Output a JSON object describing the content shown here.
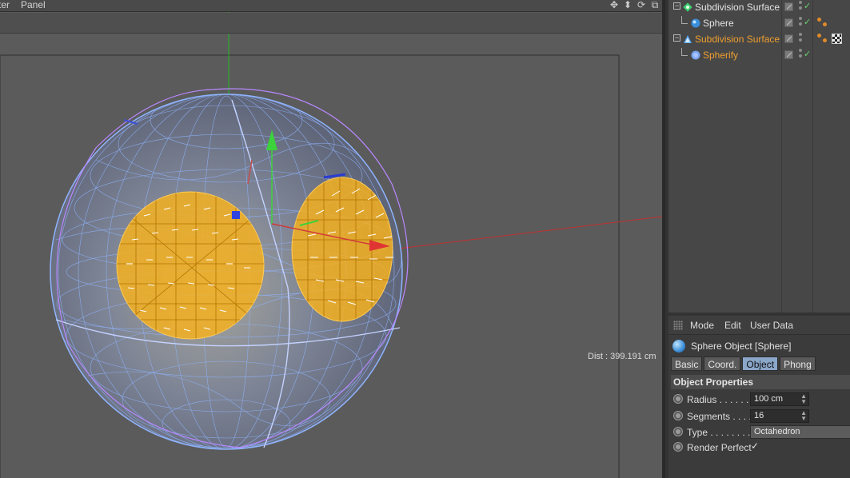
{
  "viewport": {
    "menu": [
      {
        "label": "ter"
      },
      {
        "label": "Panel"
      }
    ],
    "nav_icons": [
      "move-view-icon",
      "dolly-view-icon",
      "rotate-view-icon",
      "maximize-view-icon"
    ],
    "distance_readout": "Dist : 399.191 cm"
  },
  "object_manager": {
    "objects": [
      {
        "name": "Subdivision Surface",
        "icon": "subdivision-surface-icon",
        "highlighted": false,
        "enabled": true
      },
      {
        "name": "Sphere",
        "icon": "sphere-icon",
        "highlighted": false,
        "enabled": true,
        "tags": [
          "phong-tag-icon"
        ]
      },
      {
        "name": "Subdivision Surface",
        "icon": "subdivision-surface-icon",
        "highlighted": true,
        "enabled": false,
        "tags": [
          "phong-tag-icon",
          "texture-tag-icon"
        ]
      },
      {
        "name": "Spherify",
        "icon": "spherify-deformer-icon",
        "highlighted": true,
        "enabled": true
      }
    ]
  },
  "attribute_manager": {
    "menu": [
      {
        "label": "Mode"
      },
      {
        "label": "Edit"
      },
      {
        "label": "User Data"
      }
    ],
    "title": "Sphere Object [Sphere]",
    "tabs": [
      {
        "label": "Basic",
        "active": false
      },
      {
        "label": "Coord.",
        "active": false
      },
      {
        "label": "Object",
        "active": true
      },
      {
        "label": "Phong",
        "active": false
      }
    ],
    "section_title": "Object Properties",
    "params": {
      "radius": {
        "label": "Radius . . . . . .",
        "value": "100 cm"
      },
      "segments": {
        "label": "Segments . . . .",
        "value": "16"
      },
      "type": {
        "label": "Type . . . . . . . .",
        "value": "Octahedron"
      },
      "render_perfect": {
        "label": "Render Perfect",
        "value": "✓"
      }
    }
  },
  "colors": {
    "highlight_orange": "#f0a030",
    "active_tab": "#8aa6c8",
    "wire_blue": "#8fb4ff",
    "selection_orange": "#f5b020",
    "x_axis": "#d23b3b",
    "y_axis": "#3cd23c"
  }
}
